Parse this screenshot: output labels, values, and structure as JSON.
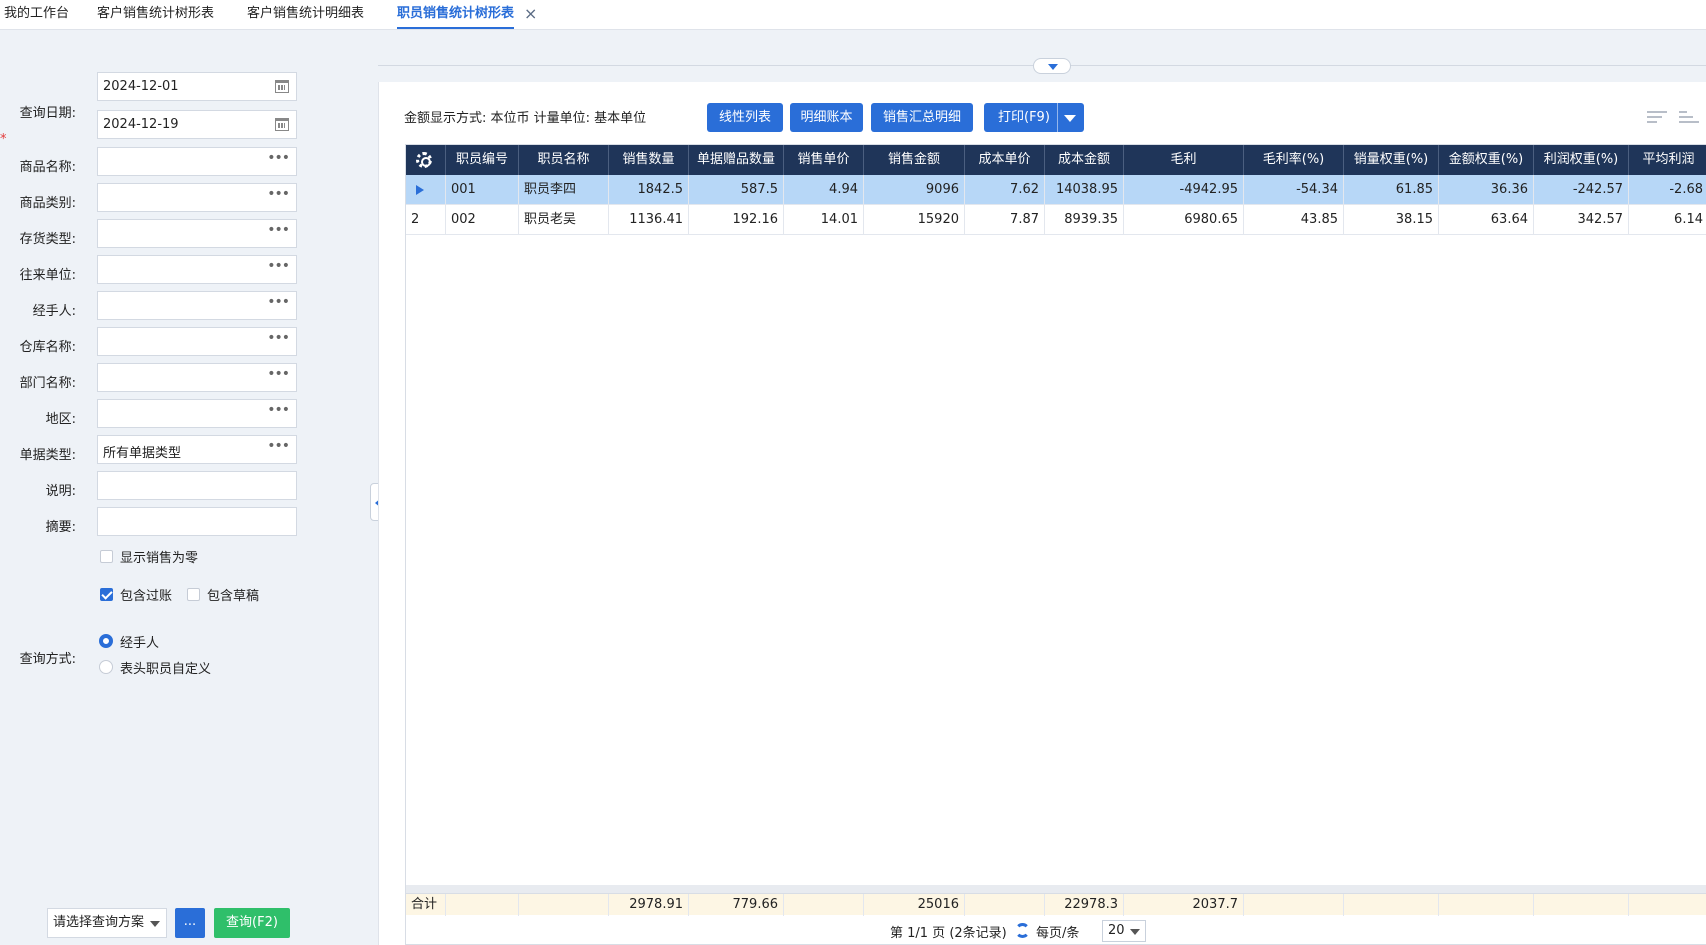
{
  "tabs": [
    {
      "label": "我的工作台"
    },
    {
      "label": "客户销售统计树形表"
    },
    {
      "label": "客户销售统计明细表"
    },
    {
      "label": "职员销售统计树形表"
    }
  ],
  "query": {
    "date_label": "查询日期:",
    "date_from": "2024-12-01",
    "date_to": "2024-12-19",
    "fields": [
      {
        "label": "商品名称:",
        "value": ""
      },
      {
        "label": "商品类别:",
        "value": ""
      },
      {
        "label": "存货类型:",
        "value": ""
      },
      {
        "label": "往来单位:",
        "value": ""
      },
      {
        "label": "经手人:",
        "value": ""
      },
      {
        "label": "仓库名称:",
        "value": ""
      },
      {
        "label": "部门名称:",
        "value": ""
      },
      {
        "label": "地区:",
        "value": ""
      },
      {
        "label": "单据类型:",
        "value": "所有单据类型"
      },
      {
        "label": "说明:",
        "value": ""
      },
      {
        "label": "摘要:",
        "value": ""
      }
    ],
    "show_zero_label": "显示销售为零",
    "show_zero_checked": false,
    "include_posted_label": "包含过账",
    "include_posted_checked": true,
    "include_draft_label": "包含草稿",
    "include_draft_checked": false,
    "method_label": "查询方式:",
    "method_options": [
      "经手人",
      "表头职员自定义"
    ],
    "method_selected": "经手人",
    "plan_placeholder": "请选择查询方案",
    "more_label": "...",
    "query_label": "查询(F2)"
  },
  "toolbar": {
    "amount_display": "金额显示方式: 本位币  计量单位: 基本单位",
    "buttons": [
      "线性列表",
      "明细账本",
      "销售汇总明细",
      "打印(F9)"
    ]
  },
  "table": {
    "columns": [
      "职员编号",
      "职员名称",
      "销售数量",
      "单据赠品数量",
      "销售单价",
      "销售金额",
      "成本单价",
      "成本金额",
      "毛利",
      "毛利率(%)",
      "销量权重(%)",
      "金额权重(%)",
      "利润权重(%)",
      "平均利润"
    ],
    "rows": [
      {
        "idx": "",
        "selected": true,
        "cells": [
          "001",
          "职员李四",
          "1842.5",
          "587.5",
          "4.94",
          "9096",
          "7.62",
          "14038.95",
          "-4942.95",
          "-54.34",
          "61.85",
          "36.36",
          "-242.57",
          "-2.68"
        ]
      },
      {
        "idx": "2",
        "selected": false,
        "cells": [
          "002",
          "职员老吴",
          "1136.41",
          "192.16",
          "14.01",
          "15920",
          "7.87",
          "8939.35",
          "6980.65",
          "43.85",
          "38.15",
          "63.64",
          "342.57",
          "6.14"
        ]
      }
    ],
    "footer": {
      "label": "合计",
      "cells": [
        "",
        "",
        "2978.91",
        "779.66",
        "",
        "25016",
        "",
        "22978.3",
        "2037.7",
        "",
        "",
        "",
        "",
        ""
      ]
    }
  },
  "pager": {
    "page_info": "第 1/1 页 (2条记录)",
    "per_page_label": "每页/条",
    "per_page_value": "20"
  },
  "colors": {
    "accent": "#2a6ed8",
    "header_bg": "#1f3559",
    "selected_row": "#b7d7f7",
    "query_btn": "#2fbf6a"
  }
}
